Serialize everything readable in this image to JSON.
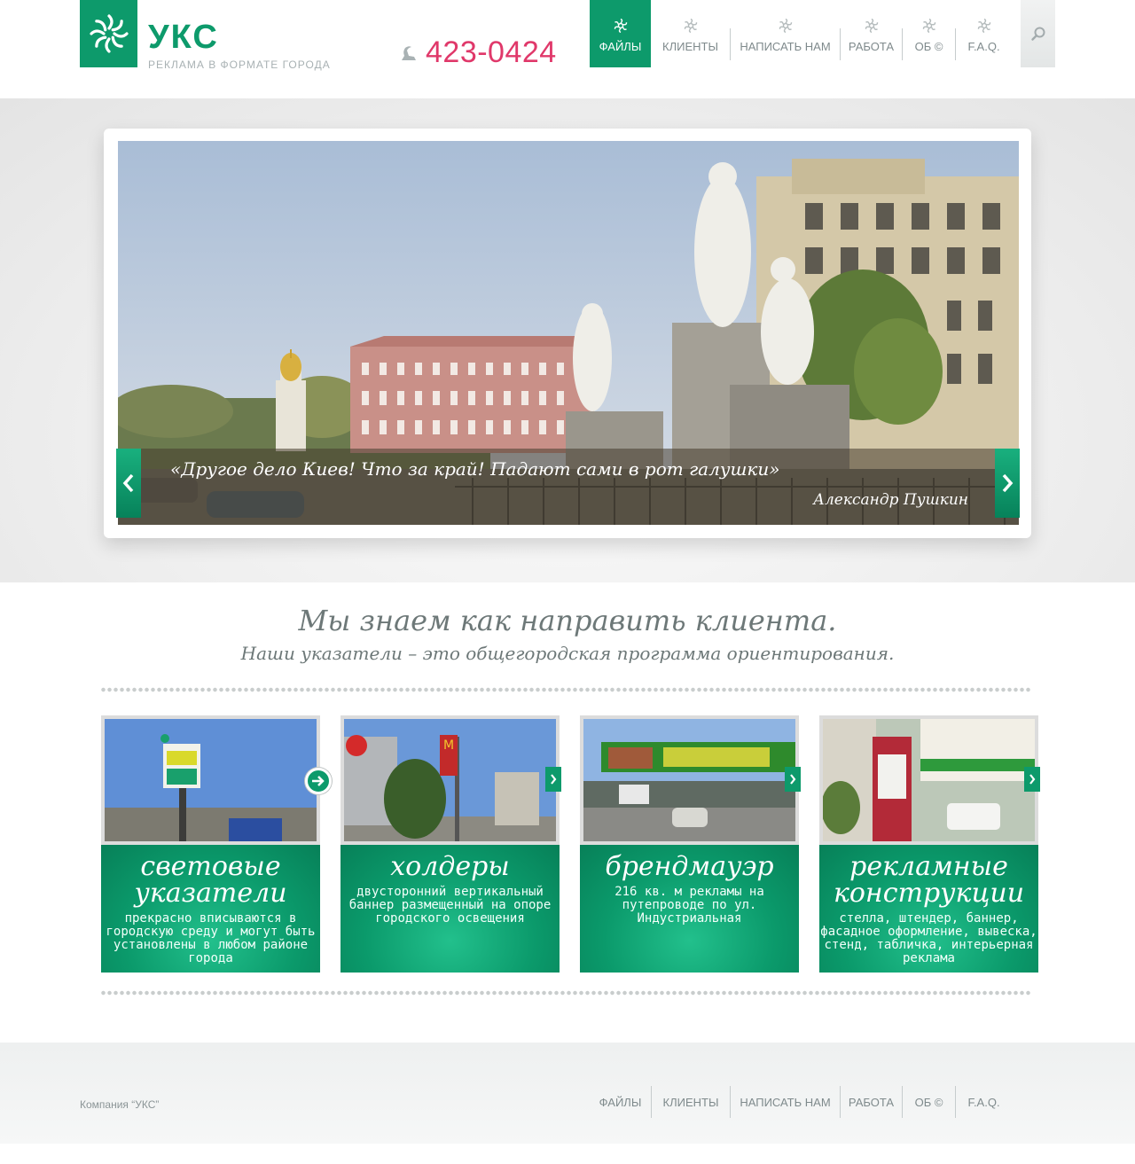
{
  "brand": {
    "name": "УКС",
    "tagline": "РЕКЛАМА В ФОРМАТЕ ГОРОДА",
    "accent": "#0d9a6b"
  },
  "phone": {
    "number": "423-0424",
    "color": "#e0386a"
  },
  "nav": {
    "items": [
      {
        "label": "ФАЙЛЫ",
        "active": true
      },
      {
        "label": "КЛИЕНТЫ"
      },
      {
        "label": "НАПИСАТЬ НАМ"
      },
      {
        "label": "РАБОТА"
      },
      {
        "label": "ОБ ©"
      },
      {
        "label": "F.A.Q."
      }
    ],
    "search_icon": "search-icon"
  },
  "hero": {
    "quote": "«Другое дело Киев! Что за край! Падают сами в рот галушки»",
    "author": "Александр Пушкин"
  },
  "slogan": {
    "main": "Мы знаем как направить клиента.",
    "sub": "Наши указатели – это общегородская программа ориентирования."
  },
  "cards": [
    {
      "title": "световые указатели",
      "text": "прекрасно вписываются в городскую среду и могут быть установлены в любом районе города"
    },
    {
      "title": "холдеры",
      "text": "двусторонний вертикальный баннер размещенный на опоре городского освещения"
    },
    {
      "title": "брендмауэр",
      "text": "216 кв. м рекламы на путепроводе по ул. Индустриальная"
    },
    {
      "title": "рекламные конструкции",
      "text": "стелла, штендер, баннер, фасадное оформление, вывеска, стенд, табличка, интерьерная реклама"
    }
  ],
  "footer": {
    "copyright": "Компания “УКС”",
    "nav": [
      "ФАЙЛЫ",
      "КЛИЕНТЫ",
      "НАПИСАТЬ НАМ",
      "РАБОТА",
      "ОБ ©",
      "F.A.Q."
    ]
  }
}
